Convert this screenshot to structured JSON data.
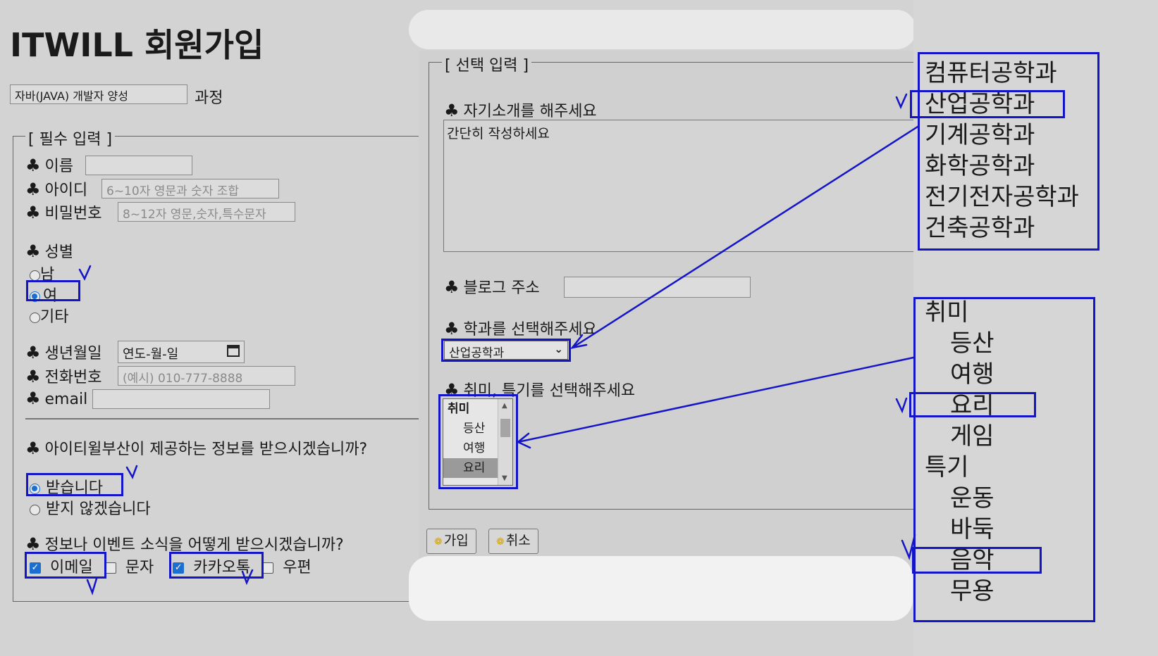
{
  "page": {
    "title": "ITWILL 회원가입",
    "course": {
      "value": "자바(JAVA) 개발자 양성",
      "suffix": "과정"
    }
  },
  "required": {
    "legend": "[ 필수 입력 ]",
    "club": "♣",
    "name_label": "이름",
    "id_label": "아이디",
    "id_placeholder": "6~10자 영문과 숫자 조합",
    "pw_label": "비밀번호",
    "pw_placeholder": "8~12자 영문,숫자,특수문자",
    "gender_label": "성별",
    "gender_options": [
      "남",
      "여",
      "기타"
    ],
    "gender_selected": "여",
    "birth_label": "생년월일",
    "birth_placeholder": "연도-월-일",
    "phone_label": "전화번호",
    "phone_placeholder": "(예시) 010-777-8888",
    "email_label": "email",
    "info_question": "아이티윌부산이 제공하는 정보를 받으시겠습니까?",
    "info_options": [
      "받습니다",
      "받지 않겠습니다"
    ],
    "info_selected": "받습니다",
    "event_question": "정보나 이벤트 소식을 어떻게 받으시겠습니까?",
    "event_options": [
      {
        "label": "이메일",
        "checked": true
      },
      {
        "label": "문자",
        "checked": false
      },
      {
        "label": "카카오톡",
        "checked": true
      },
      {
        "label": "우편",
        "checked": false
      }
    ]
  },
  "optional": {
    "legend": "[ 선택 입력 ]",
    "intro_label": "자기소개를 해주세요",
    "intro_value": "간단히 작성하세요",
    "blog_label": "블로그 주소",
    "dept_label": "학과를 선택해주세요",
    "dept_selected": "산업공학과",
    "hobby_label": "취미, 특기를 선택해주세요",
    "hobby_list": [
      {
        "text": "취미",
        "group": true
      },
      {
        "text": "등산"
      },
      {
        "text": "여행"
      },
      {
        "text": "요리",
        "selected": true
      }
    ],
    "join_button": "가입",
    "cancel_button": "취소"
  },
  "annotations": {
    "departments": [
      "컴퓨터공학과",
      "산업공학과",
      "기계공학과",
      "화학공학과",
      "전기전자공학과",
      "건축공학과"
    ],
    "hobby_groups": [
      {
        "group": "취미",
        "items": [
          "등산",
          "여행",
          "요리",
          "게임"
        ]
      },
      {
        "group": "특기",
        "items": [
          "운동",
          "바둑",
          "음악",
          "무용"
        ]
      }
    ]
  },
  "colors": {
    "annotation_blue": "#1515c8",
    "checked_blue": "#1a6fd0",
    "background": "#d3d3d3"
  }
}
